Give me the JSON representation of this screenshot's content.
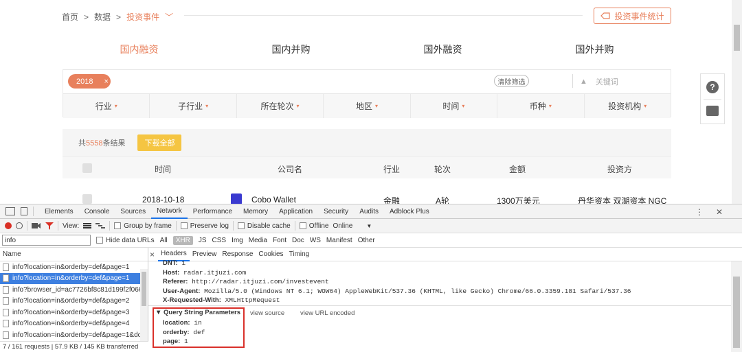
{
  "breadcrumb": {
    "home": "首页",
    "sep": ">",
    "data": "数据",
    "current": "投资事件",
    "caret": "﹀"
  },
  "stat_button": "投资事件统计",
  "tabs": [
    "国内融资",
    "国内并购",
    "国外融资",
    "国外并购"
  ],
  "filter": {
    "tag": "2018",
    "tag_close": "×",
    "clear": "清除筛选",
    "keyword_placeholder": "关键词",
    "keyword_icon": "▲",
    "columns": [
      "行业",
      "子行业",
      "所在轮次",
      "地区",
      "时间",
      "币种",
      "投资机构"
    ],
    "caret": "▾"
  },
  "results": {
    "prefix": "共",
    "count": "5558",
    "suffix": "条结果",
    "download": "下载全部"
  },
  "table": {
    "headers": [
      "时间",
      "公司名",
      "行业",
      "轮次",
      "金额",
      "投资方"
    ],
    "rows": [
      {
        "date": "2018-10-18",
        "company": "Cobo Wallet",
        "industry": "金融",
        "round": "A轮",
        "amount": "1300万美元",
        "investors": "丹华资本 双湖资本 NGC"
      }
    ]
  },
  "side": {
    "help": "?"
  },
  "devtools": {
    "panels": [
      "Elements",
      "Console",
      "Sources",
      "Network",
      "Performance",
      "Memory",
      "Application",
      "Security",
      "Audits",
      "Adblock Plus"
    ],
    "active_panel": "Network",
    "menu_icon": "⋮",
    "close_icon": "✕",
    "toolbar": {
      "view": "View:",
      "group": "Group by frame",
      "preserve": "Preserve log",
      "disable_cache": "Disable cache",
      "offline": "Offline",
      "online": "Online",
      "dropdown": "▼"
    },
    "filter_value": "info",
    "filter_types": [
      "Hide data URLs",
      "All",
      "XHR",
      "JS",
      "CSS",
      "Img",
      "Media",
      "Font",
      "Doc",
      "WS",
      "Manifest",
      "Other"
    ],
    "name_header": "Name",
    "requests": [
      "info?location=in&orderby=def&page=1",
      "info?location=in&orderby=def&page=1",
      "info?browser_id=ac7726bf8c81d199f2f066e",
      "info?location=in&orderby=def&page=2",
      "info?location=in&orderby=def&page=3",
      "info?location=in&orderby=def&page=4",
      "info?location=in&orderby=def&page=1&do"
    ],
    "status": "7 / 161 requests  |  57.9 KB / 145 KB transferred",
    "detail_tabs": [
      "Headers",
      "Preview",
      "Response",
      "Cookies",
      "Timing"
    ],
    "detail_close": "×",
    "headers": [
      {
        "k": "DNT:",
        "v": "1"
      },
      {
        "k": "Host:",
        "v": "radar.itjuzi.com"
      },
      {
        "k": "Referer:",
        "v": "http://radar.itjuzi.com/investevent"
      },
      {
        "k": "User-Agent:",
        "v": "Mozilla/5.0 (Windows NT 6.1; WOW64) AppleWebKit/537.36 (KHTML, like Gecko) Chrome/66.0.3359.181 Safari/537.36"
      },
      {
        "k": "X-Requested-With:",
        "v": "XMLHttpRequest"
      }
    ],
    "qsp_title": "▼ Query String Parameters",
    "view_source": "view source",
    "view_url": "view URL encoded",
    "params": [
      {
        "k": "location:",
        "v": "in"
      },
      {
        "k": "orderby:",
        "v": "def"
      },
      {
        "k": "page:",
        "v": "1"
      }
    ]
  }
}
